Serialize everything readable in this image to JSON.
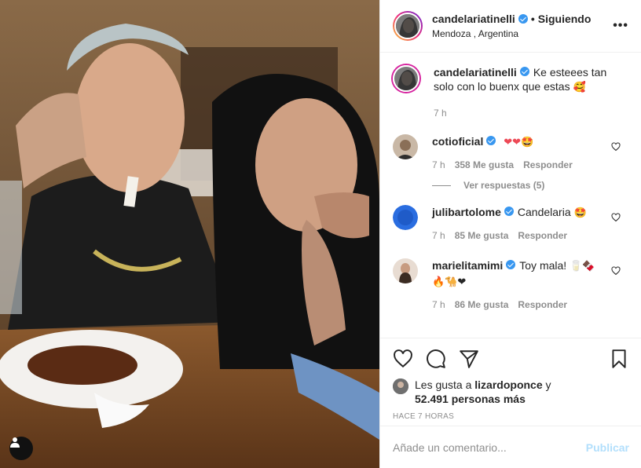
{
  "header": {
    "username": "candelariatinelli",
    "separator": "•",
    "follow_status": "Siguiendo",
    "location": "Mendoza , Argentina",
    "more_icon": "ellipsis-icon"
  },
  "caption": {
    "username": "candelariatinelli",
    "text": "Ke esteees tan solo con lo buenx que estas",
    "emoji": "🥰",
    "time": "7 h"
  },
  "comments": [
    {
      "username": "cotioficial",
      "text": "",
      "emoji": "❤❤🤩",
      "time": "7 h",
      "likes": "358 Me gusta",
      "reply": "Responder"
    },
    {
      "username": "julibartolome",
      "text": "Candelaria",
      "emoji": "🤩",
      "time": "7 h",
      "likes": "85 Me gusta",
      "reply": "Responder"
    },
    {
      "username": "marielitamimi",
      "text": "Toy mala!",
      "emoji": "🥛🍫 🔥🐪❤",
      "time": "7 h",
      "likes": "86 Me gusta",
      "reply": "Responder"
    }
  ],
  "view_replies": "Ver respuestas (5)",
  "liked_by": {
    "prefix": "Les gusta a",
    "user": "lizardoponce",
    "connector": "y",
    "others": "52.491 personas más"
  },
  "post_time": "HACE 7 HORAS",
  "add_comment": {
    "placeholder": "Añade un comentario...",
    "publish": "Publicar"
  },
  "colors": {
    "verified": "#3897f0",
    "publish_disabled": "#b2dffc",
    "heart": "#ed4956"
  }
}
